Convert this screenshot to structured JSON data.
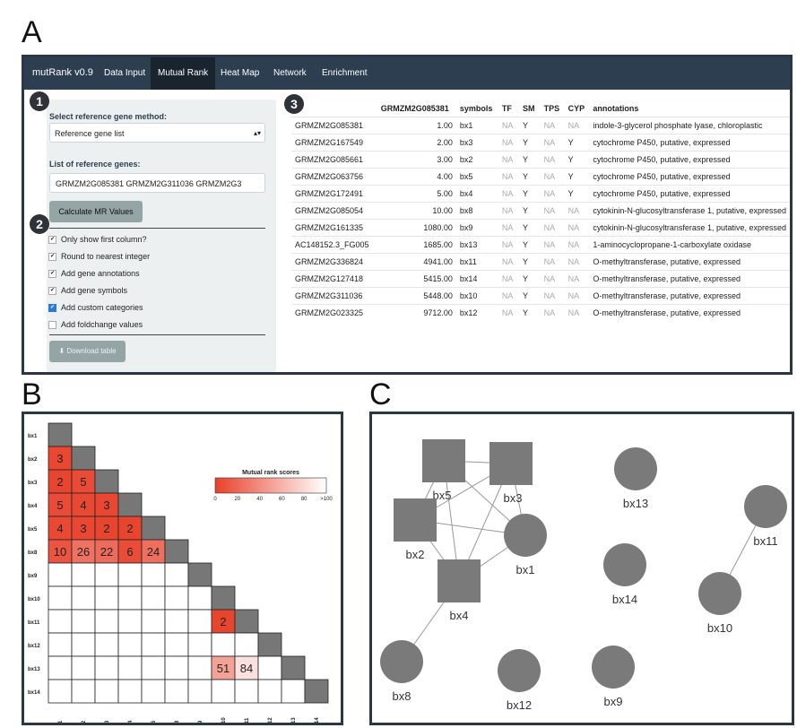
{
  "panel_labels": {
    "a": "A",
    "b": "B",
    "c": "C"
  },
  "app": {
    "brand": "mutRank v0.9",
    "tabs": [
      {
        "label": "Data Input",
        "active": false
      },
      {
        "label": "Mutual Rank",
        "active": true
      },
      {
        "label": "Heat Map",
        "active": false
      },
      {
        "label": "Network",
        "active": false
      },
      {
        "label": "Enrichment",
        "active": false
      }
    ]
  },
  "badges": [
    "1",
    "2",
    "3"
  ],
  "sidebar": {
    "method_label": "Select reference gene method:",
    "method_value": "Reference gene list",
    "genes_label": "List of reference genes:",
    "genes_value": "GRMZM2G085381 GRMZM2G311036 GRMZM2G3",
    "calc_button": "Calculate MR Values",
    "options": [
      {
        "label": "Only show first column?",
        "checked": true,
        "style": "plain"
      },
      {
        "label": "Round to nearest integer",
        "checked": true,
        "style": "plain"
      },
      {
        "label": "Add gene annotations",
        "checked": true,
        "style": "plain"
      },
      {
        "label": "Add gene symbols",
        "checked": true,
        "style": "plain"
      },
      {
        "label": "Add custom categories",
        "checked": true,
        "style": "blue"
      },
      {
        "label": "Add foldchange values",
        "checked": false,
        "style": "plain"
      }
    ],
    "download_button": "Download table",
    "download_icon": "download-icon"
  },
  "table": {
    "headers": [
      "",
      "GRMZM2G085381",
      "symbols",
      "TF",
      "SM",
      "TPS",
      "CYP",
      "annotations"
    ],
    "rows": [
      [
        "GRMZM2G085381",
        "1.00",
        "bx1",
        "NA",
        "Y",
        "NA",
        "NA",
        "indole-3-glycerol phosphate lyase, chloroplastic"
      ],
      [
        "GRMZM2G167549",
        "2.00",
        "bx3",
        "NA",
        "Y",
        "NA",
        "Y",
        "cytochrome P450, putative, expressed"
      ],
      [
        "GRMZM2G085661",
        "3.00",
        "bx2",
        "NA",
        "Y",
        "NA",
        "Y",
        "cytochrome P450, putative, expressed"
      ],
      [
        "GRMZM2G063756",
        "4.00",
        "bx5",
        "NA",
        "Y",
        "NA",
        "Y",
        "cytochrome P450, putative, expressed"
      ],
      [
        "GRMZM2G172491",
        "5.00",
        "bx4",
        "NA",
        "Y",
        "NA",
        "Y",
        "cytochrome P450, putative, expressed"
      ],
      [
        "GRMZM2G085054",
        "10.00",
        "bx8",
        "NA",
        "Y",
        "NA",
        "NA",
        "cytokinin-N-glucosyltransferase 1, putative, expressed"
      ],
      [
        "GRMZM2G161335",
        "1080.00",
        "bx9",
        "NA",
        "Y",
        "NA",
        "NA",
        "cytokinin-N-glucosyltransferase 1, putative, expressed"
      ],
      [
        "AC148152.3_FG005",
        "1685.00",
        "bx13",
        "NA",
        "Y",
        "NA",
        "NA",
        "1-aminocyclopropane-1-carboxylate oxidase"
      ],
      [
        "GRMZM2G336824",
        "4941.00",
        "bx11",
        "NA",
        "Y",
        "NA",
        "NA",
        "O-methyltransferase, putative, expressed"
      ],
      [
        "GRMZM2G127418",
        "5415.00",
        "bx14",
        "NA",
        "Y",
        "NA",
        "NA",
        "O-methyltransferase, putative, expressed"
      ],
      [
        "GRMZM2G311036",
        "5448.00",
        "bx10",
        "NA",
        "Y",
        "NA",
        "NA",
        "O-methyltransferase, putative, expressed"
      ],
      [
        "GRMZM2G023325",
        "9712.00",
        "bx12",
        "NA",
        "Y",
        "NA",
        "NA",
        "O-methyltransferase, putative, expressed"
      ]
    ]
  },
  "heatmap": {
    "genes": [
      "bx1",
      "bx2",
      "bx3",
      "bx4",
      "bx5",
      "bx8",
      "bx9",
      "bx10",
      "bx11",
      "bx12",
      "bx13",
      "bx14"
    ],
    "legend_title": "Mutual rank scores",
    "legend_ticks": [
      "0",
      "20",
      "40",
      "60",
      "80",
      ">100"
    ],
    "color_low": "#e8412b",
    "color_high": "#ffffff",
    "diag_color": "#777777",
    "values": [
      {
        "row": "bx2",
        "col": "bx1",
        "value": 3
      },
      {
        "row": "bx3",
        "col": "bx1",
        "value": 2
      },
      {
        "row": "bx3",
        "col": "bx2",
        "value": 5
      },
      {
        "row": "bx4",
        "col": "bx1",
        "value": 5
      },
      {
        "row": "bx4",
        "col": "bx2",
        "value": 4
      },
      {
        "row": "bx4",
        "col": "bx3",
        "value": 3
      },
      {
        "row": "bx5",
        "col": "bx1",
        "value": 4
      },
      {
        "row": "bx5",
        "col": "bx2",
        "value": 3
      },
      {
        "row": "bx5",
        "col": "bx3",
        "value": 2
      },
      {
        "row": "bx5",
        "col": "bx4",
        "value": 2
      },
      {
        "row": "bx8",
        "col": "bx1",
        "value": 10
      },
      {
        "row": "bx8",
        "col": "bx2",
        "value": 26
      },
      {
        "row": "bx8",
        "col": "bx3",
        "value": 22
      },
      {
        "row": "bx8",
        "col": "bx4",
        "value": 6
      },
      {
        "row": "bx8",
        "col": "bx5",
        "value": 24
      },
      {
        "row": "bx11",
        "col": "bx10",
        "value": 2
      },
      {
        "row": "bx13",
        "col": "bx10",
        "value": 51
      },
      {
        "row": "bx13",
        "col": "bx11",
        "value": 84
      }
    ]
  },
  "network": {
    "node_color": "#7a7a7a",
    "edge_color": "#999999",
    "nodes": [
      {
        "id": "bx5",
        "shape": "square"
      },
      {
        "id": "bx3",
        "shape": "square"
      },
      {
        "id": "bx2",
        "shape": "square"
      },
      {
        "id": "bx1",
        "shape": "circle"
      },
      {
        "id": "bx4",
        "shape": "square"
      },
      {
        "id": "bx13",
        "shape": "circle"
      },
      {
        "id": "bx11",
        "shape": "circle"
      },
      {
        "id": "bx14",
        "shape": "circle"
      },
      {
        "id": "bx10",
        "shape": "circle"
      },
      {
        "id": "bx8",
        "shape": "circle"
      },
      {
        "id": "bx12",
        "shape": "circle"
      },
      {
        "id": "bx9",
        "shape": "circle"
      }
    ],
    "edges": [
      [
        "bx5",
        "bx3"
      ],
      [
        "bx5",
        "bx2"
      ],
      [
        "bx5",
        "bx1"
      ],
      [
        "bx5",
        "bx4"
      ],
      [
        "bx3",
        "bx2"
      ],
      [
        "bx3",
        "bx1"
      ],
      [
        "bx3",
        "bx4"
      ],
      [
        "bx2",
        "bx1"
      ],
      [
        "bx2",
        "bx4"
      ],
      [
        "bx1",
        "bx4"
      ],
      [
        "bx4",
        "bx8"
      ],
      [
        "bx10",
        "bx11"
      ]
    ]
  }
}
